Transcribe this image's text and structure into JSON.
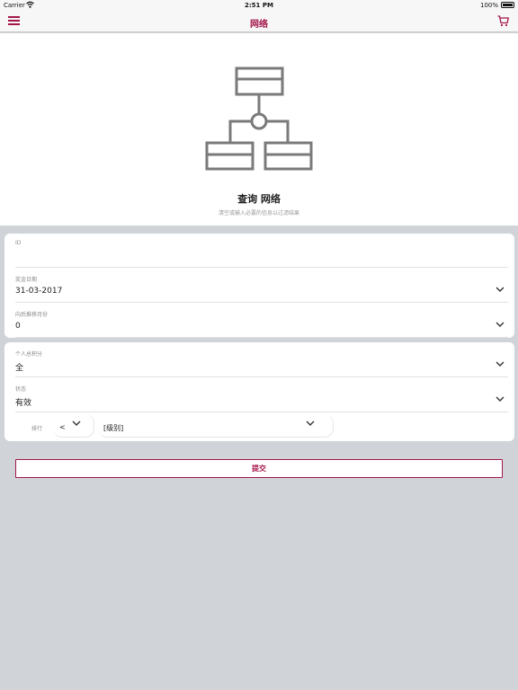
{
  "status_bar": {
    "carrier": "Carrier",
    "time": "2:51 PM",
    "battery": "100%"
  },
  "nav": {
    "title": "网络",
    "menu_icon": "hamburger-menu-icon",
    "cart_icon": "shopping-cart-icon"
  },
  "hero": {
    "icon": "network-hierarchy-icon",
    "heading": "查询 网络",
    "subtitle": "清空或输入必要的信息以过滤结果"
  },
  "filters": {
    "id": {
      "label": "ID",
      "value": ""
    },
    "bonus_date": {
      "label": "奖金日期",
      "value": "31-03-2017"
    },
    "months_back": {
      "label": "向后推移月份",
      "value": "0"
    },
    "personal_points": {
      "label": "个人总积分",
      "value": "全"
    },
    "status": {
      "label": "状态",
      "value": "有效"
    },
    "rank": {
      "label": "排行",
      "operator": "<",
      "level_placeholder": "[级别]"
    }
  },
  "submit_label": "提交",
  "colors": {
    "accent": "#a3164a",
    "background": "#d0d4d8",
    "icon_gray": "#7a7a7a"
  }
}
